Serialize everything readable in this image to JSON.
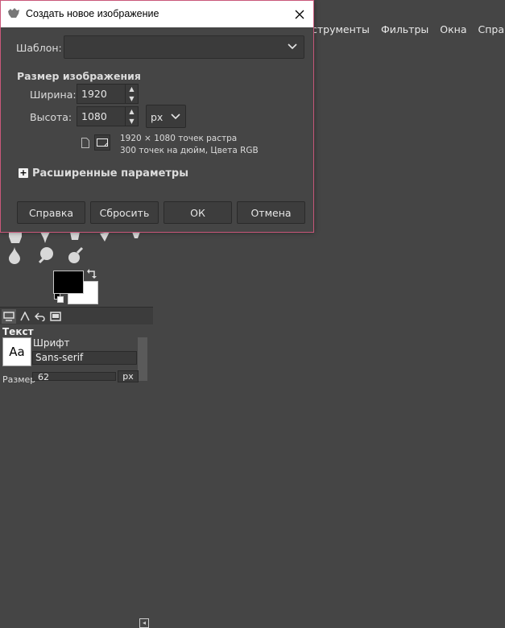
{
  "main_window": {
    "menu": [
      "струменты",
      "Фильтры",
      "Окна",
      "Справка"
    ],
    "dock": {
      "tool_options_title": "Текст",
      "font_label": "Шрифт",
      "font_value": "Sans-serif",
      "font_preview": "Aa",
      "size_label": "Размер",
      "size_value": "62",
      "size_unit": "px"
    }
  },
  "dialog": {
    "title": "Создать новое изображение",
    "template_label": "Шаблон:",
    "template_value": "",
    "size_section": "Размер изображения",
    "width_label": "Ширина:",
    "width_value": "1920",
    "height_label": "Высота:",
    "height_value": "1080",
    "unit": "px",
    "info_line1": "1920 × 1080 точек растра",
    "info_line2": "300 точек на дюйм, Цвета RGB",
    "advanced_label": "Расширенные параметры",
    "buttons": {
      "help": "Справка",
      "reset": "Сбросить",
      "ok": "ОК",
      "cancel": "Отмена"
    },
    "colors": {
      "border": "#c9577a",
      "background": "#454545"
    }
  }
}
